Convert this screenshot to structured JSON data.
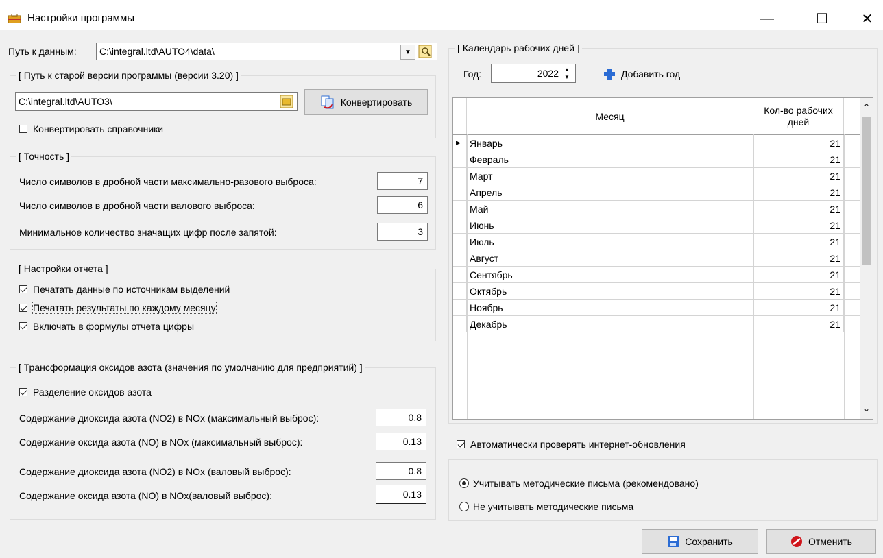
{
  "window": {
    "title": "Настройки программы",
    "minimize": "—",
    "maximize": "☐",
    "close": "✕"
  },
  "data_path": {
    "label": "Путь к данным:",
    "value": "C:\\integral.ltd\\AUTO4\\data\\"
  },
  "old_version": {
    "legend": "[ Путь к старой версии программы (версии 3.20) ]",
    "path_value": "C:\\integral.ltd\\AUTO3\\",
    "convert_button": "Конвертировать",
    "convert_refs_label": "Конвертировать справочники",
    "convert_refs_checked": false
  },
  "precision": {
    "legend": "[ Точность ]",
    "rows": [
      {
        "label": "Число символов в дробной части максимально-разового выброса:",
        "value": "7"
      },
      {
        "label": "Число символов в дробной части валового выброса:",
        "value": "6"
      },
      {
        "label": "Минимальное количество значащих цифр после запятой:",
        "value": "3"
      }
    ]
  },
  "report": {
    "legend": "[ Настройки отчета ]",
    "items": [
      {
        "label": "Печатать данные по источникам выделений",
        "checked": true
      },
      {
        "label": "Печатать результаты по каждому месяцу",
        "checked": true
      },
      {
        "label": "Включать в формулы отчета цифры",
        "checked": true
      }
    ]
  },
  "nox": {
    "legend": "[ Трансформация оксидов азота (значения по умолчанию для предприятий) ]",
    "split_label": "Разделение оксидов азота",
    "split_checked": true,
    "rows": [
      {
        "label": "Содержание диоксида азота (NO2) в NOx (максимальный выброс):",
        "value": "0.8"
      },
      {
        "label": "Содержание оксида азота (NO) в NOx (максимальный выброс):",
        "value": "0.13"
      },
      {
        "label": "Содержание диоксида азота (NO2) в NOx (валовый выброс):",
        "value": "0.8"
      },
      {
        "label": "Содержание оксида азота (NO) в NOx(валовый выброс):",
        "value": "0.13"
      }
    ]
  },
  "calendar": {
    "legend": "[ Календарь рабочих дней ]",
    "year_label": "Год:",
    "year_value": "2022",
    "add_year": "Добавить год",
    "col_month": "Месяц",
    "col_days": "Кол-во рабочих дней",
    "rows": [
      {
        "month": "Январь",
        "days": "21"
      },
      {
        "month": "Февраль",
        "days": "21"
      },
      {
        "month": "Март",
        "days": "21"
      },
      {
        "month": "Апрель",
        "days": "21"
      },
      {
        "month": "Май",
        "days": "21"
      },
      {
        "month": "Июнь",
        "days": "21"
      },
      {
        "month": "Июль",
        "days": "21"
      },
      {
        "month": "Август",
        "days": "21"
      },
      {
        "month": "Сентябрь",
        "days": "21"
      },
      {
        "month": "Октябрь",
        "days": "21"
      },
      {
        "month": "Ноябрь",
        "days": "21"
      },
      {
        "month": "Декабрь",
        "days": "21"
      }
    ]
  },
  "auto_update": {
    "label": "Автоматически проверять интернет-обновления",
    "checked": true
  },
  "letters": {
    "opt1": "Учитывать методические письма (рекомендовано)",
    "opt2": "Не учитывать методические письма",
    "selected": 0
  },
  "buttons": {
    "save": "Сохранить",
    "cancel": "Отменить"
  },
  "colors": {
    "accent_blue": "#2b6cd4",
    "cancel_red": "#d0141a",
    "folder_yellow": "#e8b92e"
  }
}
